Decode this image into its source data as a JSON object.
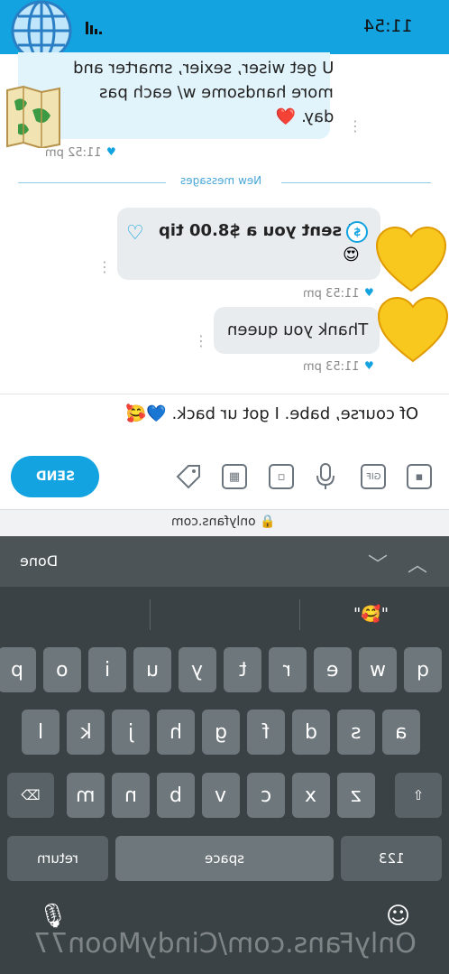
{
  "status": {
    "time": "11:54"
  },
  "chat": {
    "incoming": {
      "lines": [
        "U get wiser, sexier, smarter and",
        "more handsome w/ each pas",
        "day. ❤️"
      ],
      "time": "11:52 pm"
    },
    "divider_label": "New messages",
    "tip": {
      "text": "I sent you a $8.00 tip",
      "emoji": "😍",
      "time": "11:53 pm",
      "badge": "$"
    },
    "thanks": {
      "text": "Thank you queen",
      "time": "11:53 pm"
    }
  },
  "composer": {
    "text": "Of course, babe. I got ur back. 💙🥰",
    "send_label": "SEND",
    "tools": [
      "image-icon",
      "gif-icon",
      "mic-icon",
      "media-vault-icon",
      "schedule-icon",
      "price-tag-icon"
    ],
    "gif_label": "GIF"
  },
  "browser": {
    "url": "onlyfans.com"
  },
  "keyboard": {
    "done_label": "Done",
    "suggestion": "\"🥰\"",
    "row1": [
      "q",
      "w",
      "e",
      "r",
      "t",
      "y",
      "u",
      "i",
      "o",
      "p"
    ],
    "row2": [
      "a",
      "s",
      "d",
      "f",
      "g",
      "h",
      "j",
      "k",
      "l"
    ],
    "row3": [
      "z",
      "x",
      "c",
      "v",
      "b",
      "n",
      "m"
    ],
    "num_label": "123",
    "space_label": "space",
    "return_label": "return",
    "watermark": "OnlyFans.com/CindyMoon77"
  },
  "colors": {
    "accent": "#12a3e0",
    "keyboard_bg": "#3b4246",
    "key": "#6e777b"
  }
}
